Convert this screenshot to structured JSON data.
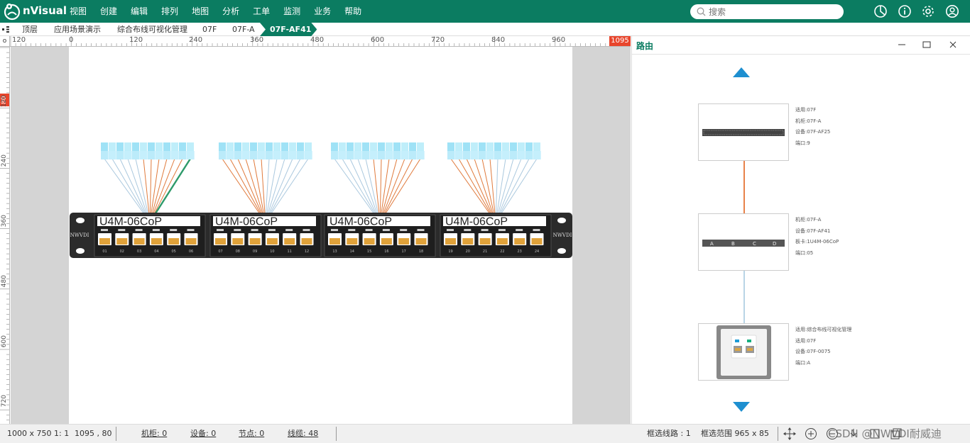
{
  "app": {
    "brand": "nVisual",
    "brand_color": "#0b7c61"
  },
  "menu": [
    "视图",
    "创建",
    "编辑",
    "排列",
    "地图",
    "分析",
    "工单",
    "监测",
    "业务",
    "帮助"
  ],
  "search": {
    "placeholder": "搜索"
  },
  "topbar_icons": [
    "pie-chart-icon",
    "info-icon",
    "gear-icon",
    "user-icon"
  ],
  "breadcrumb": [
    "顶层",
    "应用场景演示",
    "综合布线可视化管理",
    "07F",
    "07F-A",
    "07F-AF41"
  ],
  "ruler": {
    "h_ticks": [
      "120",
      "0",
      "120",
      "240",
      "360",
      "480",
      "600",
      "720",
      "840",
      "960"
    ],
    "h_marker": "1095",
    "v_ticks": [
      "120",
      "240",
      "360",
      "480",
      "600",
      "720"
    ],
    "v_marker": "80",
    "corner": "o"
  },
  "device": {
    "brand_label": "NWVDI",
    "modules": [
      {
        "label": "U4M-06CoP",
        "port_numbers": [
          "01",
          "02",
          "03",
          "04",
          "05",
          "06"
        ]
      },
      {
        "label": "U4M-06CoP",
        "port_numbers": [
          "07",
          "08",
          "09",
          "10",
          "11",
          "12"
        ]
      },
      {
        "label": "U4M-06CoP",
        "port_numbers": [
          "13",
          "14",
          "15",
          "16",
          "17",
          "18"
        ]
      },
      {
        "label": "U4M-06CoP",
        "port_numbers": [
          "19",
          "20",
          "21",
          "22",
          "23",
          "24"
        ]
      }
    ]
  },
  "panel": {
    "title": "路由",
    "controls": [
      "minimize-icon",
      "maximize-icon",
      "close-icon"
    ],
    "nodes": [
      {
        "info": [
          "适用:07F",
          "机柜:07F-A",
          "设备:07F-AF25",
          "端口:9"
        ]
      },
      {
        "info": [
          "机柜:07F-A",
          "设备:07F-AF41",
          "板卡:1U4M-06CoP",
          "端口:05"
        ],
        "slot_labels": [
          "A",
          "B",
          "C",
          "D"
        ]
      },
      {
        "info": [
          "适用:综合布线可视化管理",
          "适用:07F",
          "设备:07F-0075",
          "端口:A"
        ]
      }
    ],
    "link_colors": [
      "#e8824a",
      "#b9d4e6"
    ]
  },
  "status": {
    "canvas_size": "1000 x 750",
    "zoom": "1: 1",
    "coords": "1095 , 80",
    "cabinets": "机柜: 0",
    "devices": "设备: 0",
    "nodes": "节点: 0",
    "cables": "线缆: 48",
    "selected_lines": "框选线路 : 1",
    "selected_range": "框选范围 965 x 85",
    "watermark": "CSDN @NWVDI耐威迪"
  },
  "colors": {
    "accent": "#0b7c61",
    "orange_cable": "#e07a3c",
    "blue_cable": "#aac8de",
    "green_cable": "#2e9a6a",
    "ruler_marker": "#e8452c",
    "panel_arrow": "#1e8fd0"
  }
}
